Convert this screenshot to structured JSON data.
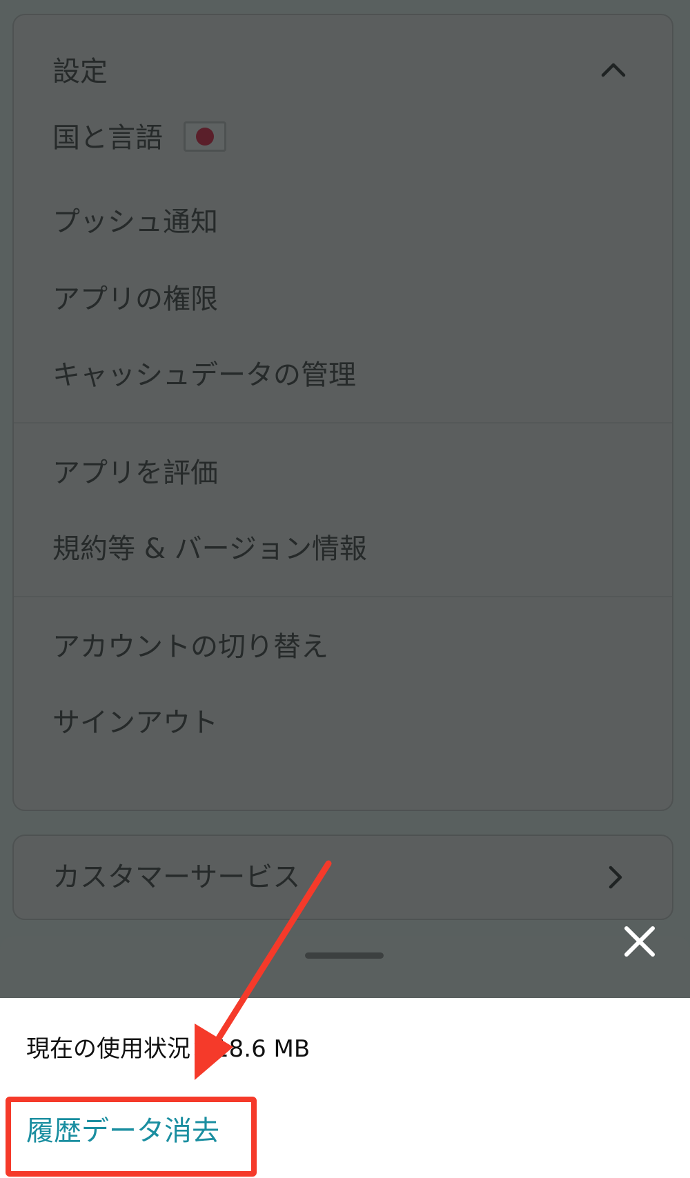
{
  "settings": {
    "title": "設定",
    "items": [
      {
        "label": "国と言語"
      },
      {
        "label": "プッシュ通知"
      },
      {
        "label": "アプリの権限"
      },
      {
        "label": "キャッシュデータの管理"
      },
      {
        "label": "アプリを評価"
      },
      {
        "label": "規約等 & バージョン情報"
      },
      {
        "label": "アカウントの切り替え"
      },
      {
        "label": "サインアウト"
      }
    ]
  },
  "customer_service": {
    "label": "カスタマーサービス"
  },
  "sheet": {
    "usage_text": "現在の使用状況：18.6 MB",
    "clear_label": "履歴データ消去"
  },
  "colors": {
    "overlay_bg": "#59605f",
    "highlight": "#f53a2a",
    "link": "#1a8ea0"
  },
  "icons": {
    "collapse": "chevron-up-icon",
    "customer_service": "chevron-right-icon",
    "close": "close-icon",
    "flag": "japan-flag-icon",
    "annotation": "red-arrow"
  }
}
